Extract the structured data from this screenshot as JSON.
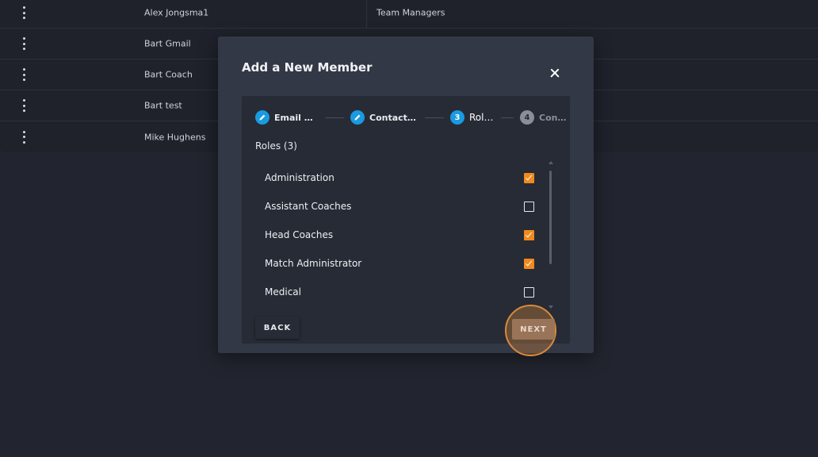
{
  "members": [
    {
      "name": "Alex Jongsma1",
      "role": "Team Managers"
    },
    {
      "name": "Bart Gmail",
      "role": ""
    },
    {
      "name": "Bart Coach",
      "role": ""
    },
    {
      "name": "Bart test",
      "role": ""
    },
    {
      "name": "Mike Hughens",
      "role": ""
    }
  ],
  "modal": {
    "title": "Add a New Member",
    "steps": [
      {
        "number": "",
        "label": "Email Ad...",
        "state": "completed",
        "icon": "pencil-icon"
      },
      {
        "number": "",
        "label": "Contact D...",
        "state": "completed",
        "icon": "pencil-icon"
      },
      {
        "number": "3",
        "label": "Roles",
        "state": "active"
      },
      {
        "number": "4",
        "label": "Confi...",
        "state": "pending"
      }
    ],
    "roles_heading": "Roles (3)",
    "roles": [
      {
        "name": "Administration",
        "checked": true
      },
      {
        "name": "Assistant Coaches",
        "checked": false
      },
      {
        "name": "Head Coaches",
        "checked": true
      },
      {
        "name": "Match Administrator",
        "checked": true
      },
      {
        "name": "Medical",
        "checked": false
      }
    ],
    "back_label": "BACK",
    "next_label": "NEXT"
  },
  "colors": {
    "background": "#22252f",
    "modal": "#333846",
    "step_active": "#1a9ae0",
    "checkbox_checked": "#f08a1c",
    "highlight": "#d98a3c"
  }
}
